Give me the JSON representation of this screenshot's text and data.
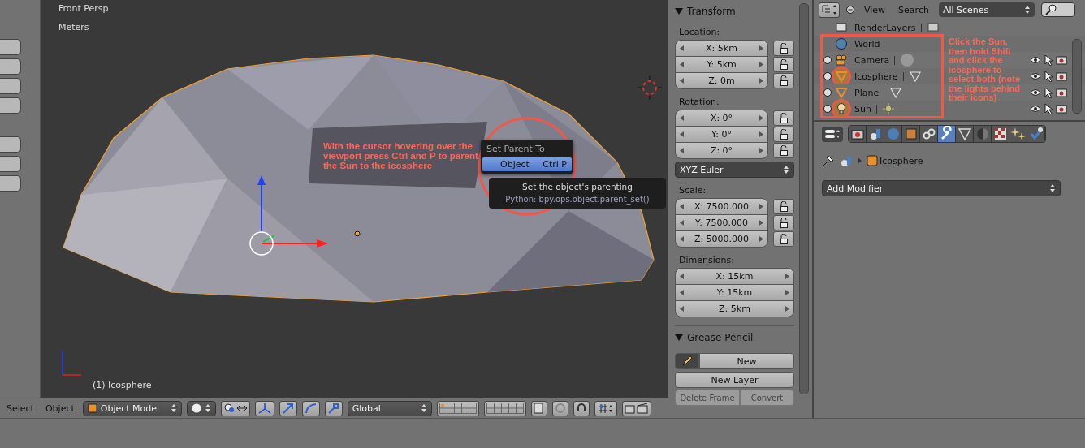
{
  "viewport": {
    "view_name": "Front Persp",
    "units": "Meters",
    "object_label": "(1) Icosphere",
    "annotation": "With the cursor hovering over the viewport press Ctrl and P to parent the Sun to the icosphere",
    "menu": {
      "title": "Set Parent To",
      "items": [
        {
          "label": "Object",
          "shortcut": "Ctrl P",
          "selected": true
        }
      ]
    },
    "tooltip": {
      "text": "Set the object's parenting",
      "python": "Python: bpy.ops.object.parent_set()"
    }
  },
  "header": {
    "menus": [
      "Select",
      "Object"
    ],
    "mode": "Object Mode",
    "orientation": "Global"
  },
  "transform": {
    "title": "Transform",
    "groups": [
      {
        "label": "Location:",
        "lockable": true,
        "fields": [
          "X: 5km",
          "Y: 5km",
          "Z: 0m"
        ]
      },
      {
        "label": "Rotation:",
        "lockable": true,
        "fields": [
          "X: 0°",
          "Y: 0°",
          "Z: 0°"
        ]
      },
      {
        "label": "Scale:",
        "lockable": true,
        "fields": [
          "X: 7500.000",
          "Y: 7500.000",
          "Z: 5000.000"
        ]
      },
      {
        "label": "Dimensions:",
        "lockable": false,
        "fields": [
          "X: 15km",
          "Y: 15km",
          "Z: 5km"
        ]
      }
    ],
    "rotation_mode": "XYZ Euler"
  },
  "grease_pencil": {
    "title": "Grease Pencil",
    "buttons": [
      {
        "label": "New",
        "disabled": false
      },
      {
        "label": "New Layer",
        "disabled": false
      },
      {
        "label": "Delete Frame",
        "disabled": true
      },
      {
        "label": "Convert",
        "disabled": true
      }
    ]
  },
  "outliner": {
    "menus": [
      "View",
      "Search"
    ],
    "scene": "All Scenes",
    "items": [
      {
        "name": "RenderLayers",
        "kind": "renderlayers",
        "selected": false,
        "circled": false
      },
      {
        "name": "World",
        "kind": "world",
        "selected": false,
        "circled": false
      },
      {
        "name": "Camera",
        "kind": "camera",
        "selected": false,
        "circled": false
      },
      {
        "name": "Icosphere",
        "kind": "mesh",
        "selected": true,
        "circled": true
      },
      {
        "name": "Plane",
        "kind": "mesh",
        "selected": false,
        "circled": false
      },
      {
        "name": "Sun",
        "kind": "lamp",
        "selected": true,
        "circled": true
      }
    ],
    "annotation": "Click the Sun, then hold Shift and click the icosphere to select both (note the lights behind their icons)"
  },
  "properties": {
    "tabs": [
      {
        "kind": "render",
        "selected": false
      },
      {
        "kind": "layers",
        "selected": false
      },
      {
        "kind": "world",
        "selected": false
      },
      {
        "kind": "object",
        "selected": false
      },
      {
        "kind": "constraints",
        "selected": false
      },
      {
        "kind": "modifiers",
        "selected": true
      },
      {
        "kind": "data",
        "selected": false
      },
      {
        "kind": "material",
        "selected": false
      },
      {
        "kind": "texture",
        "selected": false
      },
      {
        "kind": "particles",
        "selected": false
      },
      {
        "kind": "physics",
        "selected": false
      }
    ],
    "breadcrumb": "Icosphere",
    "add_modifier": "Add Modifier"
  }
}
